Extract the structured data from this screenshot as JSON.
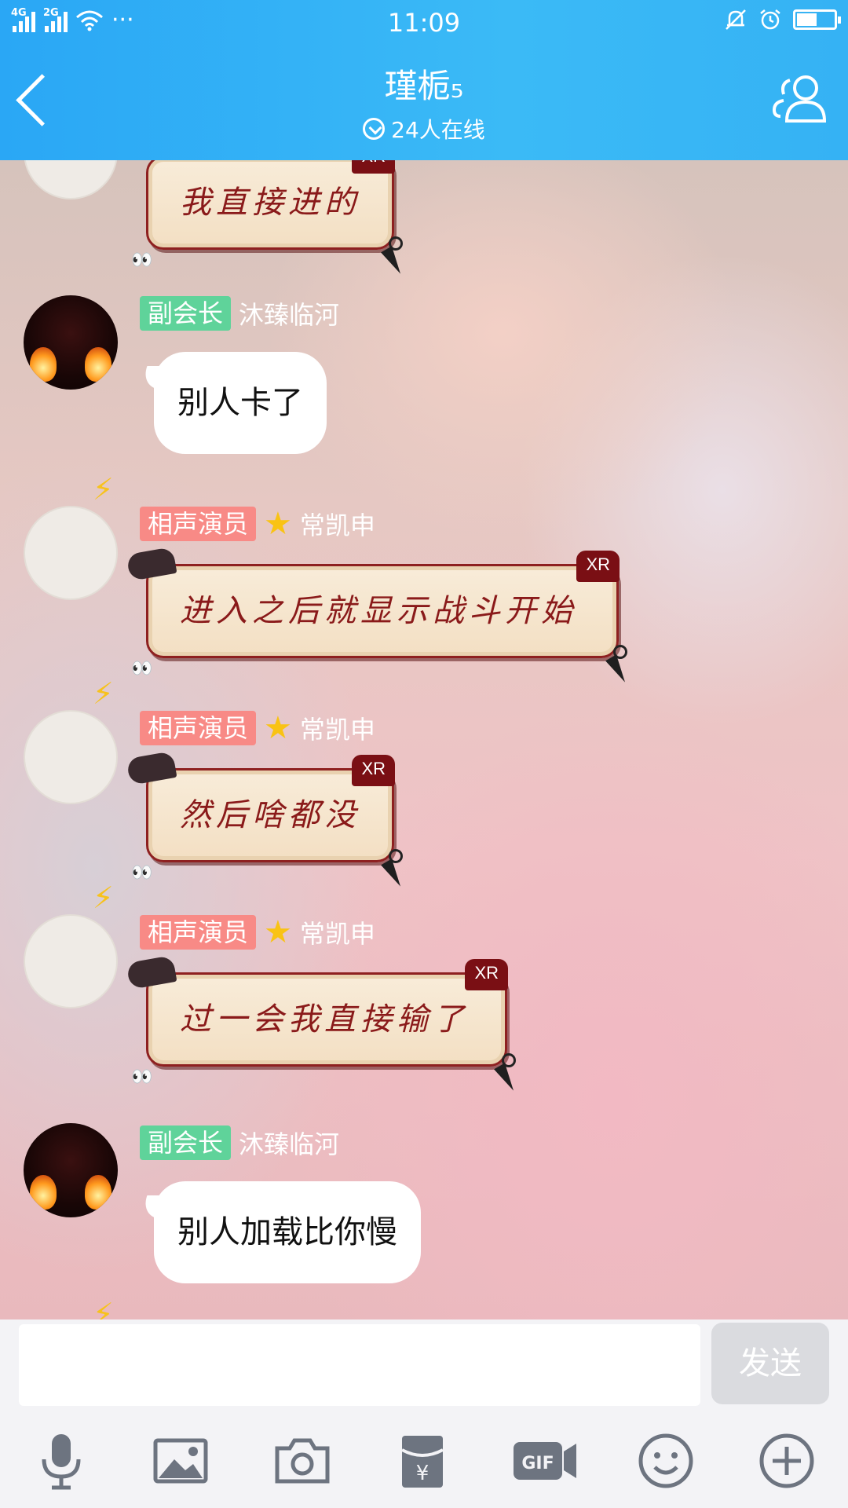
{
  "status_bar": {
    "net1": "4G",
    "net2": "2G",
    "dots": "···",
    "time": "11:09",
    "battery_level": 0.55
  },
  "header": {
    "title": "瑾栀₅",
    "online": "24人在线",
    "back_icon": "chevron-left-icon",
    "members_icon": "group-members-icon"
  },
  "messages": [
    {
      "kind": "xr",
      "text": "我直接进的",
      "tag": "XR"
    },
    {
      "kind": "white",
      "badge": "副会长",
      "badge_color": "#5fd39a",
      "name": "沐臻临河",
      "text": "别人卡了"
    },
    {
      "kind": "xr",
      "badge": "相声演员",
      "badge_color": "#f88a86",
      "name": "常凯申",
      "text": "进入之后就显示战斗开始",
      "tag": "XR"
    },
    {
      "kind": "xr",
      "badge": "相声演员",
      "badge_color": "#f88a86",
      "name": "常凯申",
      "text": "然后啥都没",
      "tag": "XR"
    },
    {
      "kind": "xr",
      "badge": "相声演员",
      "badge_color": "#f88a86",
      "name": "常凯申",
      "text": "过一会我直接输了",
      "tag": "XR"
    },
    {
      "kind": "white",
      "badge": "副会长",
      "badge_color": "#5fd39a",
      "name": "沐臻临河",
      "text": "别人加载比你慢"
    }
  ],
  "input": {
    "value": "",
    "placeholder": "",
    "send_label": "发送"
  },
  "toolbar": {
    "icons": [
      "microphone-icon",
      "image-icon",
      "camera-icon",
      "red-packet-icon",
      "gif-icon",
      "emoji-icon",
      "plus-icon"
    ],
    "gif_label": "GIF",
    "yen": "¥"
  },
  "colors": {
    "header": "#35b2f4",
    "badge_green": "#5fd39a",
    "badge_red": "#f88a86",
    "xr_border": "#8e2020",
    "xr_text": "#8a1a1a"
  }
}
